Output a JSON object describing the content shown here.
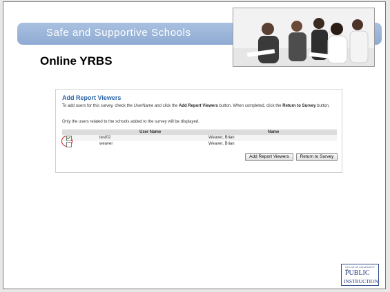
{
  "slide": {
    "title": "Safe and Supportive Schools",
    "subtitle": "Online YRBS"
  },
  "panel": {
    "heading": "Add Report Viewers",
    "instructions_pre": "To add users for this survey, check the UserName and click the ",
    "instructions_bold1": "Add Report Viewers",
    "instructions_mid": " button. When completed, click the ",
    "instructions_bold2": "Return to Survey",
    "instructions_post": " button.",
    "note": "Only the users related to the schools added to the survey will be displayed.",
    "columns": {
      "username": "User Name",
      "name": "Name"
    },
    "rows": [
      {
        "username": "test02",
        "name": "Weaver, Brian",
        "checked": true
      },
      {
        "username": "weaver",
        "name": "Weaver, Brian",
        "checked": false
      }
    ],
    "buttons": {
      "add": "Add Report Viewers",
      "return": "Return to Survey"
    }
  },
  "logo": {
    "top": "WISCONSIN DEPARTMENT OF",
    "mid": "PUBLIC",
    "bot": "INSTRUCTION"
  },
  "colors": {
    "banner": "#8fabd3",
    "heading": "#2a63a8",
    "highlight": "#c72020"
  }
}
